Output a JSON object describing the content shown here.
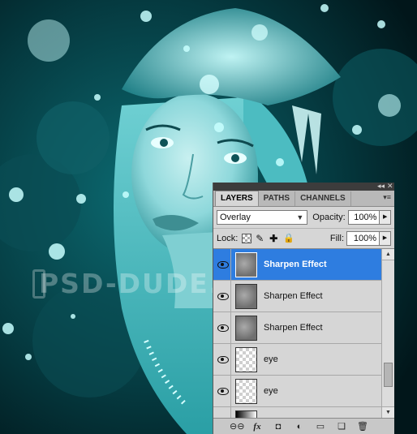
{
  "watermark": "PSD-DUDE.COM",
  "panel": {
    "tabs": [
      {
        "label": "LAYERS",
        "active": true
      },
      {
        "label": "PATHS",
        "active": false
      },
      {
        "label": "CHANNELS",
        "active": false
      }
    ],
    "blend_mode": "Overlay",
    "opacity_label": "Opacity:",
    "opacity_value": "100%",
    "lock_label": "Lock:",
    "fill_label": "Fill:",
    "fill_value": "100%",
    "layers": [
      {
        "name": "Sharpen Effect",
        "selected": true,
        "visible": true,
        "thumb": "gray"
      },
      {
        "name": "Sharpen Effect",
        "selected": false,
        "visible": true,
        "thumb": "gray"
      },
      {
        "name": "Sharpen Effect",
        "selected": false,
        "visible": true,
        "thumb": "gray"
      },
      {
        "name": "eye",
        "selected": false,
        "visible": true,
        "thumb": "checker"
      },
      {
        "name": "eye",
        "selected": false,
        "visible": true,
        "thumb": "checker"
      },
      {
        "name": "",
        "selected": false,
        "visible": true,
        "thumb": "gradient"
      }
    ],
    "footer_icons": [
      "link-icon",
      "fx-icon",
      "mask-icon",
      "adjustment-icon",
      "folder-icon",
      "new-layer-icon",
      "trash-icon"
    ]
  },
  "colors": {
    "selection": "#2e7de0",
    "panel_bg": "#d6d6d6",
    "artwork_tint": "#2fd3d8"
  }
}
